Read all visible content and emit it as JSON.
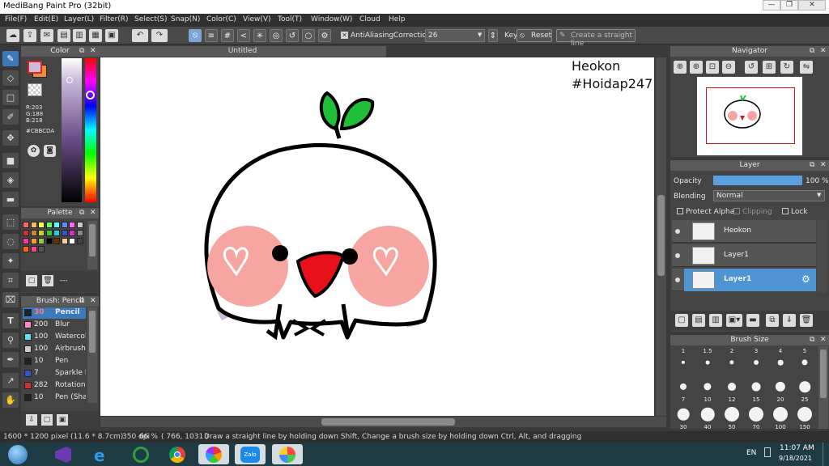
{
  "window": {
    "title": "MediBang Paint Pro (32bit)"
  },
  "menu": [
    "File(F)",
    "Edit(E)",
    "Layer(L)",
    "Filter(R)",
    "Select(S)",
    "Snap(N)",
    "Color(C)",
    "View(V)",
    "Tool(T)",
    "Window(W)",
    "Cloud",
    "Help"
  ],
  "toolbar": {
    "antialiasing_label": "AntiAliasing",
    "correction_label": "Correction",
    "correction_value": "26",
    "key_label": "Key",
    "reset_label": "Reset",
    "straight_line_label": "Create a straight line"
  },
  "color_panel": {
    "title": "Color",
    "r": "R:203",
    "g": "G:188",
    "b": "B:218",
    "hex": "#CBBCDA",
    "primary": "#CBBCDA",
    "secondary": "#f28b33"
  },
  "palette_panel": {
    "title": "Palette",
    "colors": [
      "#ff6666",
      "#ffbb55",
      "#ffff55",
      "#66ff66",
      "#55ffff",
      "#6688ff",
      "#ff66ff",
      "#cccccc",
      "#cc3333",
      "#cc8833",
      "#cccc33",
      "#33cc33",
      "#33cccc",
      "#3355cc",
      "#cc33cc",
      "#888888",
      "#ff3399",
      "#ff9933",
      "#99cc33",
      "#000000",
      "#663300",
      "#ffcc99",
      "#ffffff",
      "#444444",
      "#ff6600",
      "#ff4488",
      "#555555"
    ],
    "footer": "---"
  },
  "brush_panel": {
    "title": "Brush: Pencil",
    "items": [
      {
        "size": "30",
        "name": "Pencil",
        "color": "#222222",
        "selected": true
      },
      {
        "size": "200",
        "name": "Blur",
        "color": "#ff88cc"
      },
      {
        "size": "100",
        "name": "Watercolor",
        "color": "#66ddff"
      },
      {
        "size": "100",
        "name": "Airbrush",
        "color": "#cccccc"
      },
      {
        "size": "10",
        "name": "Pen",
        "color": "#222222"
      },
      {
        "size": "7",
        "name": "Sparkle B",
        "color": "#3355cc"
      },
      {
        "size": "282",
        "name": "Rotation",
        "color": "#cc3333"
      },
      {
        "size": "10",
        "name": "Pen (Sha",
        "color": "#222222"
      }
    ]
  },
  "canvas": {
    "tab_title": "Untitled",
    "watermark_line1": "Heokon",
    "watermark_line2": "#Hoidap247"
  },
  "navigator": {
    "title": "Navigator"
  },
  "layer_panel": {
    "title": "Layer",
    "opacity_label": "Opacity",
    "opacity_value": "100 %",
    "opacity_fraction": 1.0,
    "blending_label": "Blending",
    "blending_value": "Normal",
    "protect_alpha": "Protect Alpha",
    "clipping": "Clipping",
    "lock": "Lock",
    "layers": [
      {
        "name": "Heokon",
        "selected": false
      },
      {
        "name": "Layer1",
        "selected": false
      },
      {
        "name": "Layer1",
        "selected": true
      }
    ]
  },
  "brush_size_panel": {
    "title": "Brush Size",
    "sizes": [
      "1",
      "1.5",
      "2",
      "3",
      "4",
      "5",
      "7",
      "10",
      "12",
      "15",
      "20",
      "25",
      "30",
      "40",
      "50",
      "70",
      "100",
      "150"
    ]
  },
  "statusbar": {
    "size": "1600 * 1200 pixel",
    "physical": "(11.6 * 8.7cm)",
    "dpi": "350 dpi",
    "zoom": "66 %",
    "coords": "( 766, 1031 )",
    "hint": "Draw a straight line by holding down Shift, Change a brush size by holding down Ctrl, Alt, and dragging"
  },
  "taskbar": {
    "lang": "EN",
    "time": "11:07 AM",
    "date": "9/18/2021",
    "apps": [
      "start",
      "visual-studio",
      "internet-explorer",
      "coccoc",
      "chrome",
      "picasa",
      "zalo",
      "medibang"
    ]
  }
}
